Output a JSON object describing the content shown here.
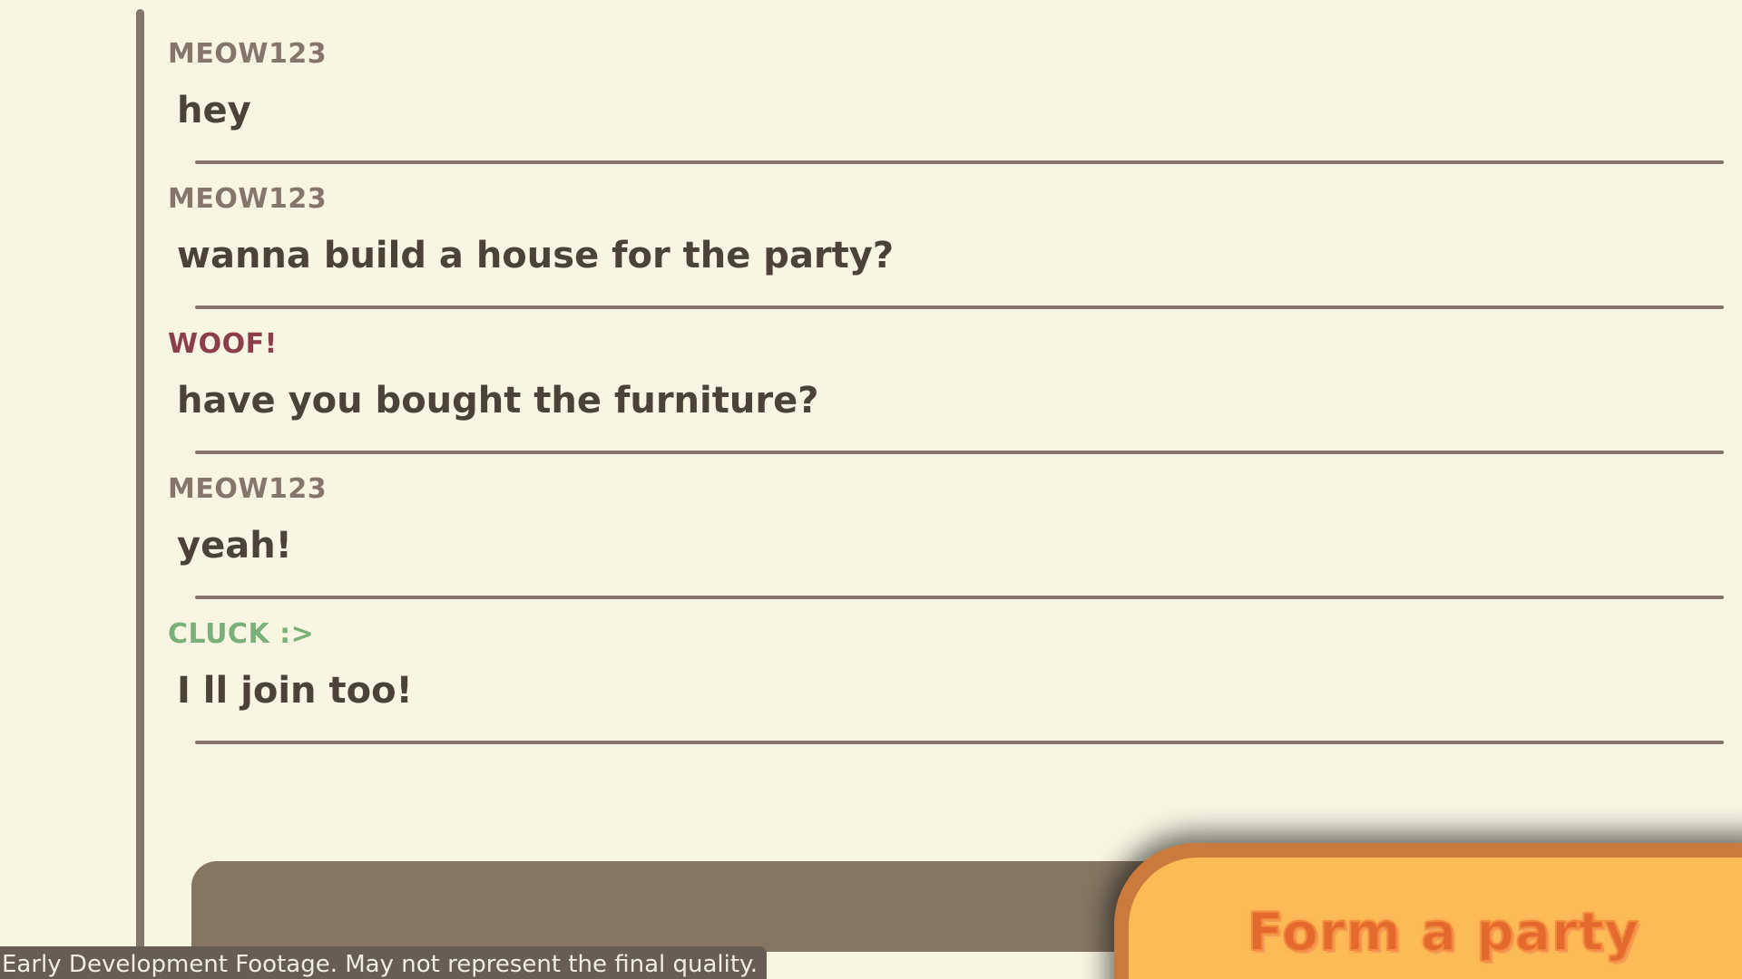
{
  "chat": {
    "messages": [
      {
        "sender": "MEOW123",
        "text": "hey",
        "sender_class": "meow"
      },
      {
        "sender": "MEOW123",
        "text": "wanna build a house for the party?",
        "sender_class": "meow"
      },
      {
        "sender": "WOOF!",
        "text": "have you bought the furniture?",
        "sender_class": "woof"
      },
      {
        "sender": "MEOW123",
        "text": "yeah!",
        "sender_class": "meow"
      },
      {
        "sender": "CLUCK :>",
        "text": "I ll join too!",
        "sender_class": "cluck"
      }
    ],
    "input": {
      "value": "",
      "placeholder": ""
    }
  },
  "party_button": {
    "label": "Form a party"
  },
  "footer": {
    "notice": "Early Development Footage. May not represent the final quality."
  },
  "colors": {
    "background": "#f8f5e2",
    "border": "#85766a",
    "meow": "#85766a",
    "woof": "#8c3f48",
    "cluck": "#7ab07a",
    "button": "#fdbb57",
    "button_text": "#e36a2c"
  }
}
